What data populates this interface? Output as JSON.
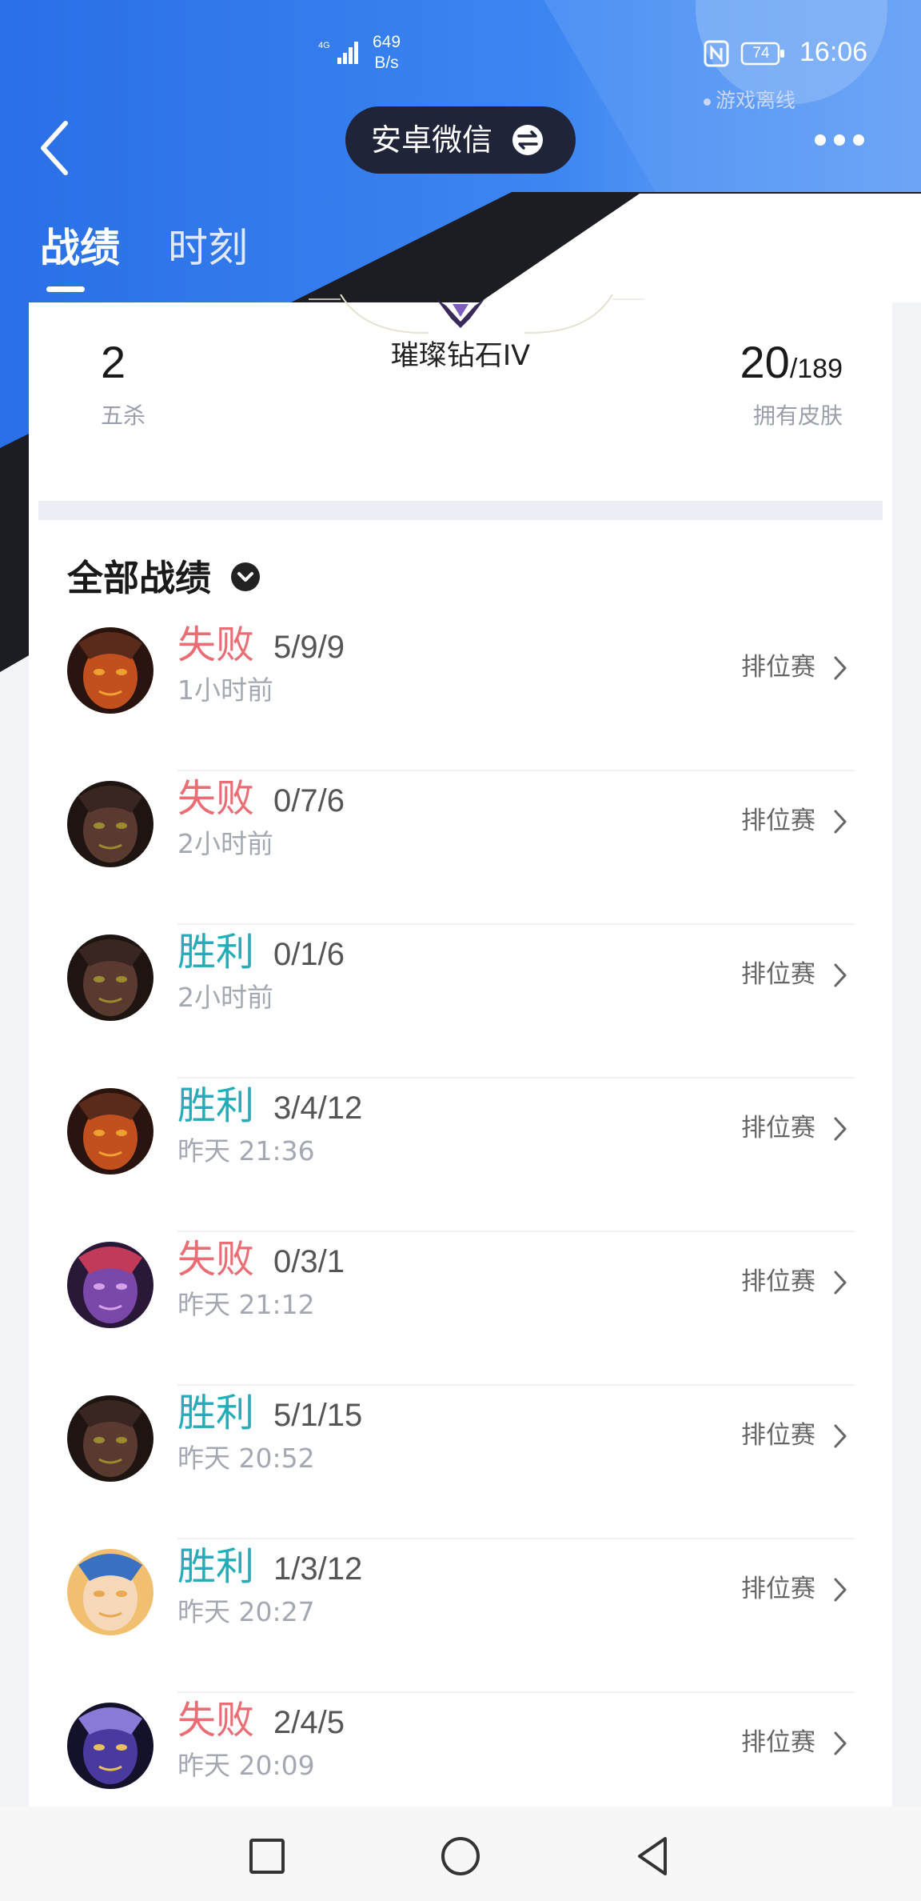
{
  "status_bar": {
    "network": "4G",
    "rate": "649",
    "rate_unit": "B/s",
    "battery": "74",
    "time": "16:06",
    "presence": "游戏离线"
  },
  "nav": {
    "account_name": "安卓微信",
    "icons": {
      "back": "back-chevron-icon",
      "switch": "switch-account-icon",
      "more": "more-dots-icon"
    }
  },
  "tabs": [
    {
      "label": "战绩",
      "active": true
    },
    {
      "label": "时刻",
      "active": false
    }
  ],
  "stats": {
    "rank": "璀璨钻石IV",
    "pentakills": "2",
    "pentakills_label": "五杀",
    "skins_owned": "20",
    "skins_total": "/189",
    "skins_label": "拥有皮肤"
  },
  "history": {
    "title": "全部战绩",
    "matches": [
      {
        "result": "失败",
        "kda": "5/9/9",
        "time": "1小时前",
        "mode": "排位赛",
        "win": false,
        "champion_icon": "champion-avatar-fire"
      },
      {
        "result": "失败",
        "kda": "0/7/6",
        "time": "2小时前",
        "mode": "排位赛",
        "win": false,
        "champion_icon": "champion-avatar-dark"
      },
      {
        "result": "胜利",
        "kda": "0/1/6",
        "time": "2小时前",
        "mode": "排位赛",
        "win": true,
        "champion_icon": "champion-avatar-dark"
      },
      {
        "result": "胜利",
        "kda": "3/4/12",
        "time": "昨天 21:36",
        "mode": "排位赛",
        "win": true,
        "champion_icon": "champion-avatar-fire"
      },
      {
        "result": "失败",
        "kda": "0/3/1",
        "time": "昨天 21:12",
        "mode": "排位赛",
        "win": false,
        "champion_icon": "champion-avatar-purple"
      },
      {
        "result": "胜利",
        "kda": "5/1/15",
        "time": "昨天 20:52",
        "mode": "排位赛",
        "win": true,
        "champion_icon": "champion-avatar-dark"
      },
      {
        "result": "胜利",
        "kda": "1/3/12",
        "time": "昨天 20:27",
        "mode": "排位赛",
        "win": true,
        "champion_icon": "champion-avatar-blonde"
      },
      {
        "result": "失败",
        "kda": "2/4/5",
        "time": "昨天 20:09",
        "mode": "排位赛",
        "win": false,
        "champion_icon": "champion-avatar-masked"
      }
    ]
  },
  "colors": {
    "header_blue": "#2f7cf0",
    "loss": "#ea6d76",
    "win": "#26abb8",
    "dark_band": "#1c1d22"
  }
}
